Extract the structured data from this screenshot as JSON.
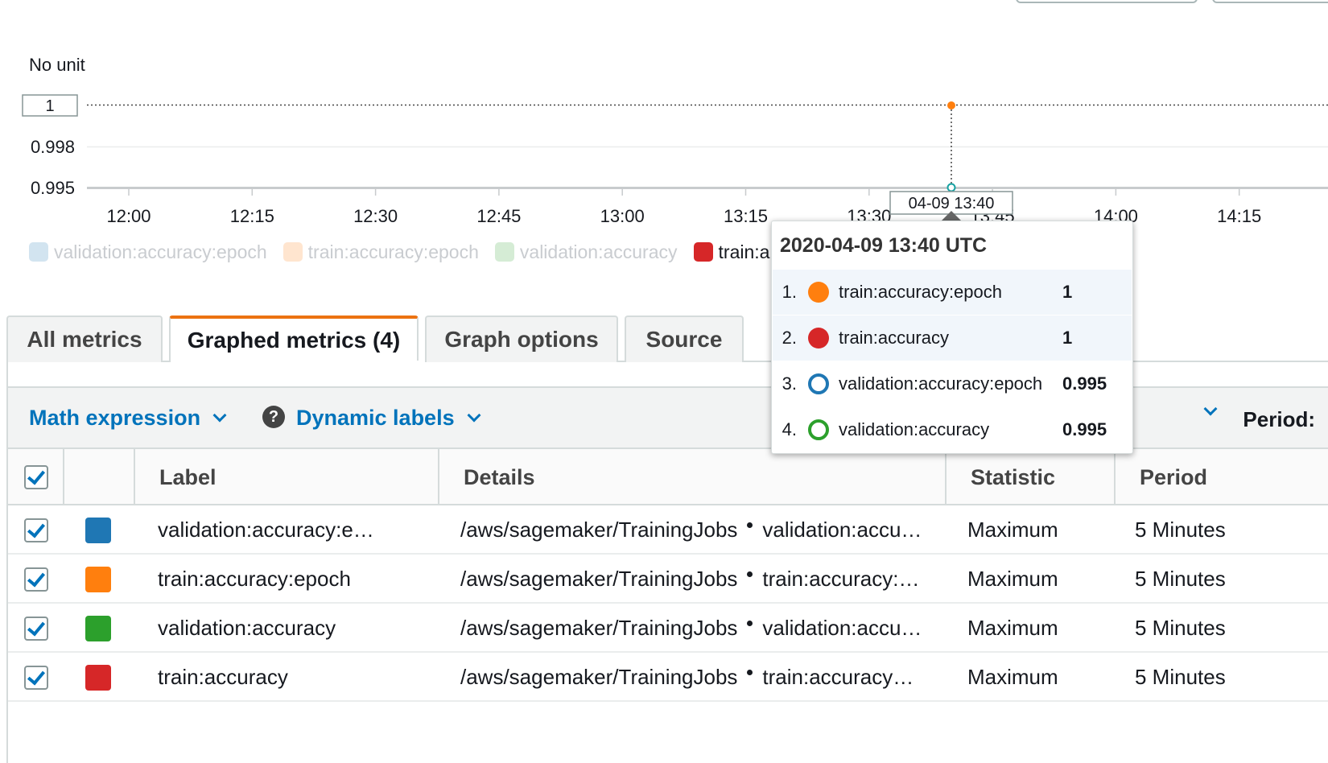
{
  "chart": {
    "unit_label": "No unit",
    "y_ticks": [
      "1",
      "0.998",
      "0.995"
    ],
    "x_ticks": [
      "12:00",
      "12:15",
      "12:30",
      "12:45",
      "13:00",
      "13:15",
      "13:30",
      "13:45",
      "14:00",
      "14:15"
    ],
    "cursor_label": "04-09 13:40",
    "highlight_color": "#ff7f0e"
  },
  "chart_data": {
    "type": "line",
    "title": "",
    "xlabel": "",
    "ylabel": "No unit",
    "x": [
      "13:40"
    ],
    "series": [
      {
        "name": "train:accuracy:epoch",
        "values": [
          1
        ]
      },
      {
        "name": "train:accuracy",
        "values": [
          1
        ]
      },
      {
        "name": "validation:accuracy:epoch",
        "values": [
          0.995
        ]
      },
      {
        "name": "validation:accuracy",
        "values": [
          0.995
        ]
      }
    ]
  },
  "legend": [
    {
      "label": "validation:accuracy:epoch",
      "color": "#1f77b4",
      "faded": true
    },
    {
      "label": "train:accuracy:epoch",
      "color": "#ff7f0e",
      "faded": true
    },
    {
      "label": "validation:accuracy",
      "color": "#2ca02c",
      "faded": true
    },
    {
      "label": "train:a",
      "color": "#d62728",
      "faded": false
    }
  ],
  "tooltip": {
    "title": "2020-04-09 13:40 UTC",
    "rows": [
      {
        "num": "1.",
        "label": "train:accuracy:epoch",
        "value": "1",
        "color": "#ff7f0e",
        "ring": false
      },
      {
        "num": "2.",
        "label": "train:accuracy",
        "value": "1",
        "color": "#d62728",
        "ring": false
      },
      {
        "num": "3.",
        "label": "validation:accuracy:epoch",
        "value": "0.995",
        "color": "#1f77b4",
        "ring": true
      },
      {
        "num": "4.",
        "label": "validation:accuracy",
        "value": "0.995",
        "color": "#2ca02c",
        "ring": true
      }
    ]
  },
  "tabs": [
    {
      "label": "All metrics",
      "active": false
    },
    {
      "label": "Graphed metrics (4)",
      "active": true
    },
    {
      "label": "Graph options",
      "active": false
    },
    {
      "label": "Source",
      "active": false
    }
  ],
  "toolbar": {
    "math_expression": "Math expression",
    "help": "?",
    "dynamic_labels": "Dynamic labels",
    "period": "Period:"
  },
  "table": {
    "headers": {
      "label": "Label",
      "details": "Details",
      "statistic": "Statistic",
      "period": "Period"
    },
    "rows": [
      {
        "color": "#1f77b4",
        "label": "validation:accuracy:e…",
        "namespace": "/aws/sagemaker/TrainingJobs",
        "metric": "validation:accu…",
        "statistic": "Maximum",
        "period": "5 Minutes"
      },
      {
        "color": "#ff7f0e",
        "label": "train:accuracy:epoch",
        "namespace": "/aws/sagemaker/TrainingJobs",
        "metric": "train:accuracy:…",
        "statistic": "Maximum",
        "period": "5 Minutes"
      },
      {
        "color": "#2ca02c",
        "label": "validation:accuracy",
        "namespace": "/aws/sagemaker/TrainingJobs",
        "metric": "validation:accu…",
        "statistic": "Maximum",
        "period": "5 Minutes"
      },
      {
        "color": "#d62728",
        "label": "train:accuracy",
        "namespace": "/aws/sagemaker/TrainingJobs",
        "metric": "train:accuracy…",
        "statistic": "Maximum",
        "period": "5 Minutes"
      }
    ]
  }
}
